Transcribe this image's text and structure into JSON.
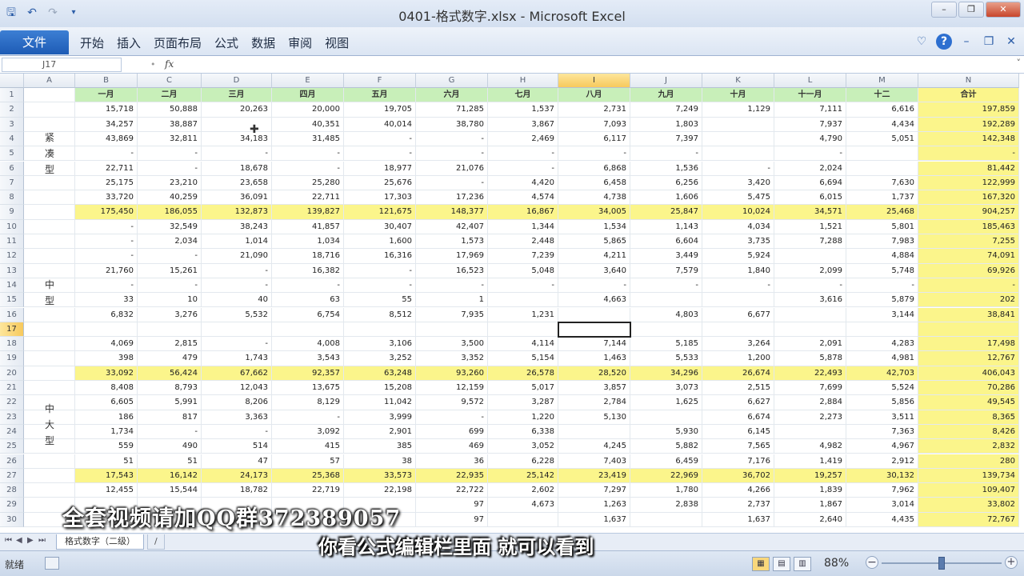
{
  "window": {
    "title": "0401-格式数字.xlsx - Microsoft Excel",
    "qat_icons": [
      "save-icon",
      "undo-icon",
      "redo-icon",
      "customize-icon"
    ]
  },
  "ribbon": {
    "file_tab": "文件",
    "tabs": [
      "开始",
      "插入",
      "页面布局",
      "公式",
      "数据",
      "审阅",
      "视图"
    ]
  },
  "formula_bar": {
    "name_box": "J17",
    "fx": "fx",
    "content": ""
  },
  "sheet": {
    "columns": [
      "A",
      "B",
      "C",
      "D",
      "E",
      "F",
      "G",
      "H",
      "I",
      "J",
      "K",
      "L",
      "M",
      "N"
    ],
    "selected_column": "I",
    "selected_row": 17,
    "header_row": [
      "",
      "一月",
      "二月",
      "三月",
      "四月",
      "五月",
      "六月",
      "七月",
      "八月",
      "九月",
      "十月",
      "十一月",
      "十二",
      "合计"
    ],
    "rows": [
      {
        "n": 2,
        "v": [
          "",
          "15,718",
          "50,888",
          "20,263",
          "20,000",
          "19,705",
          "71,285",
          "1,537",
          "2,731",
          "7,249",
          "1,129",
          "7,111",
          "6,616",
          "197,859"
        ]
      },
      {
        "n": 3,
        "v": [
          "",
          "34,257",
          "38,887",
          "",
          "40,351",
          "40,014",
          "38,780",
          "3,867",
          "7,093",
          "1,803",
          "",
          "7,937",
          "4,434",
          "192,289"
        ]
      },
      {
        "n": 4,
        "v": [
          "",
          "43,869",
          "32,811",
          "34,183",
          "31,485",
          "-",
          "-",
          "2,469",
          "6,117",
          "7,397",
          "",
          "4,790",
          "5,051",
          "142,348"
        ]
      },
      {
        "n": 5,
        "v": [
          "",
          "-",
          "-",
          "-",
          "-",
          "-",
          "-",
          "-",
          "-",
          "-",
          "",
          "-",
          "",
          "-"
        ]
      },
      {
        "n": 6,
        "v": [
          "",
          "22,711",
          "-",
          "18,678",
          "-",
          "18,977",
          "21,076",
          "-",
          "6,868",
          "1,536",
          "-",
          "2,024",
          "",
          "81,442"
        ]
      },
      {
        "n": 7,
        "v": [
          "",
          "25,175",
          "23,210",
          "23,658",
          "25,280",
          "25,676",
          "-",
          "4,420",
          "6,458",
          "6,256",
          "3,420",
          "6,694",
          "7,630",
          "122,999"
        ]
      },
      {
        "n": 8,
        "v": [
          "",
          "33,720",
          "40,259",
          "36,091",
          "22,711",
          "17,303",
          "17,236",
          "4,574",
          "4,738",
          "1,606",
          "5,475",
          "6,015",
          "1,737",
          "167,320"
        ]
      },
      {
        "n": 9,
        "v": [
          "",
          "175,450",
          "186,055",
          "132,873",
          "139,827",
          "121,675",
          "148,377",
          "16,867",
          "34,005",
          "25,847",
          "10,024",
          "34,571",
          "25,468",
          "904,257"
        ],
        "total": true
      },
      {
        "n": 10,
        "v": [
          "",
          "-",
          "32,549",
          "38,243",
          "41,857",
          "30,407",
          "42,407",
          "1,344",
          "1,534",
          "1,143",
          "4,034",
          "1,521",
          "5,801",
          "185,463"
        ]
      },
      {
        "n": 11,
        "v": [
          "",
          "-",
          "2,034",
          "1,014",
          "1,034",
          "1,600",
          "1,573",
          "2,448",
          "5,865",
          "6,604",
          "3,735",
          "7,288",
          "7,983",
          "7,255"
        ]
      },
      {
        "n": 12,
        "v": [
          "",
          "-",
          "-",
          "21,090",
          "18,716",
          "16,316",
          "17,969",
          "7,239",
          "4,211",
          "3,449",
          "5,924",
          "",
          "4,884",
          "74,091"
        ]
      },
      {
        "n": 13,
        "v": [
          "",
          "21,760",
          "15,261",
          "-",
          "16,382",
          "-",
          "16,523",
          "5,048",
          "3,640",
          "7,579",
          "1,840",
          "2,099",
          "5,748",
          "69,926"
        ]
      },
      {
        "n": 14,
        "v": [
          "",
          "-",
          "-",
          "-",
          "-",
          "-",
          "-",
          "-",
          "-",
          "-",
          "-",
          "-",
          "-",
          "-"
        ]
      },
      {
        "n": 15,
        "v": [
          "",
          "33",
          "10",
          "40",
          "63",
          "55",
          "1",
          "",
          "4,663",
          "",
          "",
          "3,616",
          "5,879",
          "202"
        ]
      },
      {
        "n": 16,
        "v": [
          "",
          "6,832",
          "3,276",
          "5,532",
          "6,754",
          "8,512",
          "7,935",
          "1,231",
          "",
          "4,803",
          "6,677",
          "",
          "3,144",
          "38,841"
        ]
      },
      {
        "n": 17,
        "v": [
          "",
          "",
          "",
          "",
          "",
          "",
          "",
          "",
          "",
          "",
          "",
          "",
          "",
          ""
        ]
      },
      {
        "n": 18,
        "v": [
          "",
          "4,069",
          "2,815",
          "-",
          "4,008",
          "3,106",
          "3,500",
          "4,114",
          "7,144",
          "5,185",
          "3,264",
          "2,091",
          "4,283",
          "17,498"
        ]
      },
      {
        "n": 19,
        "v": [
          "",
          "398",
          "479",
          "1,743",
          "3,543",
          "3,252",
          "3,352",
          "5,154",
          "1,463",
          "5,533",
          "1,200",
          "5,878",
          "4,981",
          "12,767"
        ]
      },
      {
        "n": 20,
        "v": [
          "",
          "33,092",
          "56,424",
          "67,662",
          "92,357",
          "63,248",
          "93,260",
          "26,578",
          "28,520",
          "34,296",
          "26,674",
          "22,493",
          "42,703",
          "406,043"
        ],
        "total": true
      },
      {
        "n": 21,
        "v": [
          "",
          "8,408",
          "8,793",
          "12,043",
          "13,675",
          "15,208",
          "12,159",
          "5,017",
          "3,857",
          "3,073",
          "2,515",
          "7,699",
          "5,524",
          "70,286"
        ]
      },
      {
        "n": 22,
        "v": [
          "",
          "6,605",
          "5,991",
          "8,206",
          "8,129",
          "11,042",
          "9,572",
          "3,287",
          "2,784",
          "1,625",
          "6,627",
          "2,884",
          "5,856",
          "49,545"
        ]
      },
      {
        "n": 23,
        "v": [
          "",
          "186",
          "817",
          "3,363",
          "-",
          "3,999",
          "-",
          "1,220",
          "5,130",
          "",
          "6,674",
          "2,273",
          "3,511",
          "8,365"
        ]
      },
      {
        "n": 24,
        "v": [
          "",
          "1,734",
          "-",
          "-",
          "3,092",
          "2,901",
          "699",
          "6,338",
          "",
          "5,930",
          "6,145",
          "",
          "7,363",
          "8,426"
        ]
      },
      {
        "n": 25,
        "v": [
          "",
          "559",
          "490",
          "514",
          "415",
          "385",
          "469",
          "3,052",
          "4,245",
          "5,882",
          "7,565",
          "4,982",
          "4,967",
          "2,832"
        ]
      },
      {
        "n": 26,
        "v": [
          "",
          "51",
          "51",
          "47",
          "57",
          "38",
          "36",
          "6,228",
          "7,403",
          "6,459",
          "7,176",
          "1,419",
          "2,912",
          "280"
        ]
      },
      {
        "n": 27,
        "v": [
          "",
          "17,543",
          "16,142",
          "24,173",
          "25,368",
          "33,573",
          "22,935",
          "25,142",
          "23,419",
          "22,969",
          "36,702",
          "19,257",
          "30,132",
          "139,734"
        ],
        "total": true
      },
      {
        "n": 28,
        "v": [
          "",
          "12,455",
          "15,544",
          "18,782",
          "22,719",
          "22,198",
          "22,722",
          "2,602",
          "7,297",
          "1,780",
          "4,266",
          "1,839",
          "7,962",
          "109,407"
        ]
      },
      {
        "n": 29,
        "v": [
          "",
          "",
          "",
          "",
          "",
          "",
          "97",
          "4,673",
          "1,263",
          "2,838",
          "2,737",
          "1,867",
          "3,014",
          "33,802"
        ]
      },
      {
        "n": 30,
        "v": [
          "",
          "",
          "",
          "",
          "",
          "",
          "97",
          "",
          "1,637",
          "",
          "1,637",
          "2,640",
          "4,435",
          "72,767"
        ]
      }
    ],
    "groups": [
      {
        "label": "紧\n凑\n型",
        "from_row": 2,
        "to_row": 8
      },
      {
        "label": "中\n型",
        "from_row": 10,
        "to_row": 19
      },
      {
        "label": "中\n大\n型",
        "from_row": 21,
        "to_row": 26
      }
    ]
  },
  "sheet_tabs": {
    "active": "格式数字（二级）",
    "other": "/ "
  },
  "status_bar": {
    "ready": "就绪",
    "zoom": "88%",
    "zoom_fraction": 0.5
  },
  "overlays": {
    "promo": "全套视频请加QQ群372389057",
    "subtitle": "你看公式编辑栏里面 就可以看到"
  }
}
